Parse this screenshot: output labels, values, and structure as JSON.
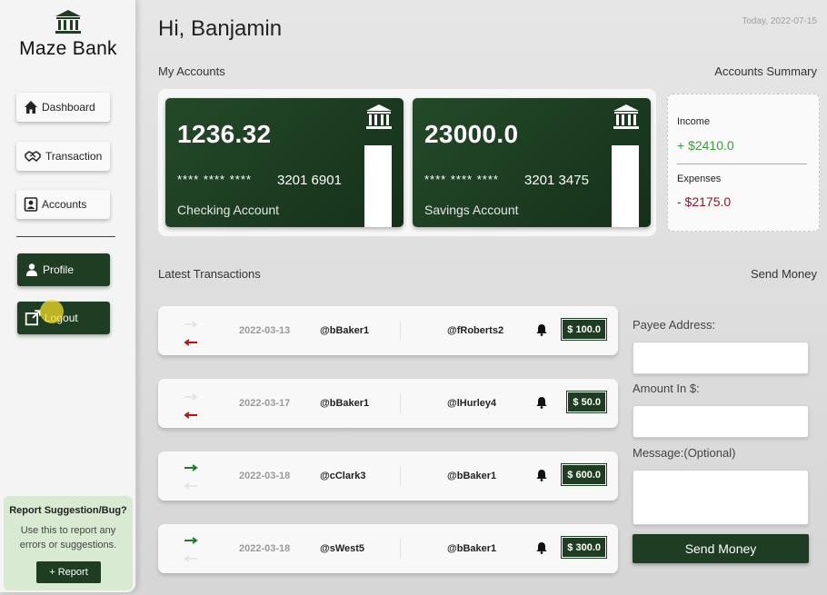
{
  "brand": {
    "name": "Maze Bank"
  },
  "sidebar": {
    "items": [
      {
        "label": "Dashboard",
        "icon": "home-icon"
      },
      {
        "label": "Transaction",
        "icon": "handshake-icon"
      },
      {
        "label": "Accounts",
        "icon": "account-box-icon"
      }
    ],
    "profile_label": "Profile",
    "logout_label": "Logout"
  },
  "report": {
    "title": "Report Suggestion/Bug?",
    "description": "Use this to report any errors or suggestions.",
    "button_label": "+ Report"
  },
  "header": {
    "greeting": "Hi, Banjamin",
    "date": "Today, 2022-07-15"
  },
  "sections": {
    "my_accounts": "My Accounts",
    "accounts_summary": "Accounts Summary",
    "latest_transactions": "Latest Transactions",
    "send_money": "Send Money"
  },
  "accounts": [
    {
      "balance": "1236.32",
      "mask": "**** **** ****",
      "number": "3201 6901",
      "type": "Checking Account"
    },
    {
      "balance": "23000.0",
      "mask": "**** **** ****",
      "number": "3201 3475",
      "type": "Savings Account"
    }
  ],
  "summary": {
    "income_label": "Income",
    "income_value": "+ $2410.0",
    "expenses_label": "Expenses",
    "expenses_value": "- $2175.0"
  },
  "transactions": [
    {
      "direction": "outgoing",
      "date": "2022-03-13",
      "sender": "@bBaker1",
      "receiver": "@fRoberts2",
      "amount": "$ 100.0"
    },
    {
      "direction": "outgoing",
      "date": "2022-03-17",
      "sender": "@bBaker1",
      "receiver": "@lHurley4",
      "amount": "$ 50.0"
    },
    {
      "direction": "incoming",
      "date": "2022-03-18",
      "sender": "@cClark3",
      "receiver": "@bBaker1",
      "amount": "$ 600.0"
    },
    {
      "direction": "incoming",
      "date": "2022-03-18",
      "sender": "@sWest5",
      "receiver": "@bBaker1",
      "amount": "$ 300.0"
    }
  ],
  "send_form": {
    "payee_label": "Payee Address:",
    "amount_label": "Amount In $:",
    "message_label": "Message:(Optional)",
    "button_label": "Send Money"
  },
  "colors": {
    "primary": "#1e3d22",
    "income": "#3c9a3c",
    "expense": "#8e1a2b",
    "outgoing_arrow": "#b01818",
    "incoming_arrow": "#1d7a2a"
  }
}
